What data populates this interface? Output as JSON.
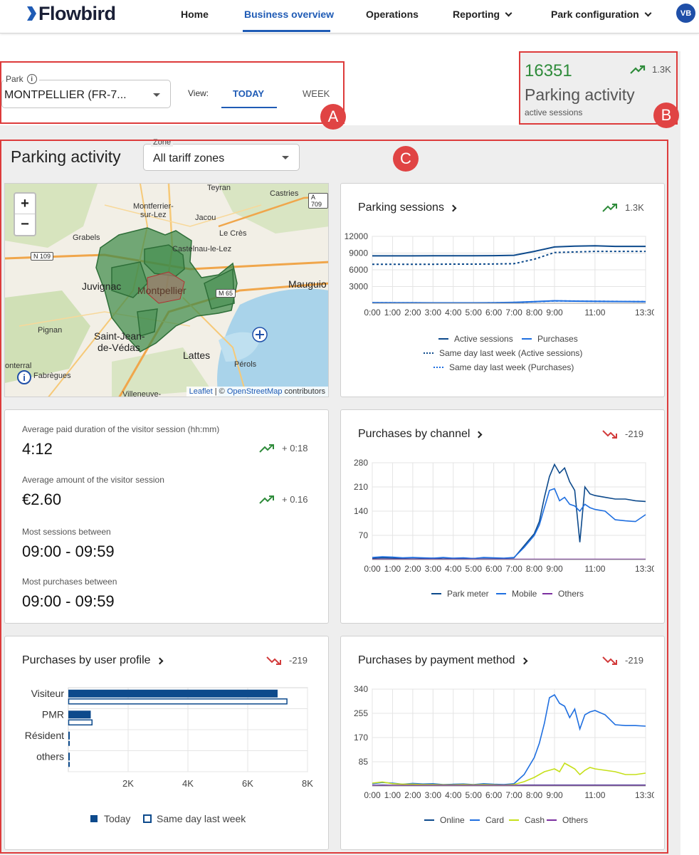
{
  "header": {
    "logo_text": "Flowbird",
    "nav": {
      "home": "Home",
      "business": "Business overview",
      "operations": "Operations",
      "reporting": "Reporting",
      "park_config": "Park configuration"
    },
    "avatar": "VB"
  },
  "filters": {
    "park_label": "Park",
    "park_value": "MONTPELLIER (FR-7...",
    "view_label": "View:",
    "view_today": "TODAY",
    "view_week": "WEEK"
  },
  "kpi": {
    "value": "16351",
    "trend": "1.3K",
    "title": "Parking activity",
    "subtitle": "active sessions"
  },
  "annotations": {
    "a": "A",
    "b": "B",
    "c": "C"
  },
  "section": {
    "title": "Parking activity",
    "zone_label": "Zone",
    "zone_value": "All tariff zones"
  },
  "map": {
    "zoom_in": "+",
    "zoom_out": "−",
    "labels": {
      "teyran": "Teyran",
      "castries": "Castries",
      "montferrier": "Montferrier-",
      "surlez": "sur-Lez",
      "jacou": "Jacou",
      "grabels": "Grabels",
      "lecres": "Le Crès",
      "castelnau": "Castelnau-le-Lez",
      "juvignac": "Juvignac",
      "montpellier": "Montpellier",
      "mauguio": "Mauguio",
      "pignan": "Pignan",
      "saintjean": "Saint-Jean-",
      "devedas": "de-Védas",
      "lattes": "Lattes",
      "perols": "Pérols",
      "onterral": "onterral",
      "fabregues": "Fabrègues",
      "villeneuve": "Villeneuve-"
    },
    "roads": {
      "n109": "N 109",
      "a709": "A 709",
      "m65": "M 65"
    },
    "attribution_leaflet": "Leaflet",
    "attribution_sep": " | © ",
    "attribution_osm": "OpenStreetMap",
    "attribution_rest": " contributors",
    "info": "i"
  },
  "cards": {
    "sessions": {
      "title": "Parking sessions",
      "trend": "1.3K",
      "legend": [
        "Active sessions",
        "Purchases",
        "Same day last week (Active sessions)",
        "Same day last week (Purchases)"
      ]
    },
    "metrics": {
      "m1_label": "Average paid duration of the visitor session (hh:mm)",
      "m1_value": "4:12",
      "m1_trend": "+ 0:18",
      "m2_label": "Average amount of the visitor session",
      "m2_value": "€2.60",
      "m2_trend": "+ 0.16",
      "m3_label": "Most sessions between",
      "m3_value": "09:00 - 09:59",
      "m4_label": "Most purchases between",
      "m4_value": "09:00 - 09:59"
    },
    "channel": {
      "title": "Purchases by channel",
      "trend": "-219",
      "legend": [
        "Park meter",
        "Mobile",
        "Others"
      ]
    },
    "profile": {
      "title": "Purchases by user profile",
      "trend": "-219",
      "legend": [
        "Today",
        "Same day last week"
      ]
    },
    "payment": {
      "title": "Purchases by payment method",
      "trend": "-219",
      "legend": [
        "Online",
        "Card",
        "Cash",
        "Others"
      ]
    }
  },
  "colors": {
    "primary": "#1f5bb5",
    "dark_blue": "#0d4a8c",
    "light_blue": "#1f6fe0",
    "green": "#2e8b3a",
    "red": "#d23b3b",
    "cash": "#c6e01a",
    "purple": "#7b2fa0",
    "zone_green": "#3e8a4a"
  },
  "chart_data": [
    {
      "type": "line",
      "title": "Parking sessions",
      "x": [
        "0:00",
        "1:00",
        "2:00",
        "3:00",
        "4:00",
        "5:00",
        "6:00",
        "7:00",
        "8:00",
        "9:00",
        "10:00",
        "11:00",
        "12:00",
        "13:30"
      ],
      "xticks": [
        "0:00",
        "1:00",
        "2:00",
        "3:00",
        "4:00",
        "5:00",
        "6:00",
        "7:00",
        "8:00",
        "9:00",
        "11:00",
        "13:30"
      ],
      "yticks": [
        3000,
        6000,
        9000,
        12000
      ],
      "ylim": [
        0,
        12000
      ],
      "series": [
        {
          "name": "Active sessions",
          "values": [
            8500,
            8500,
            8500,
            8520,
            8520,
            8520,
            8540,
            8600,
            9300,
            10100,
            10250,
            10300,
            10200,
            10200
          ]
        },
        {
          "name": "Purchases",
          "values": [
            120,
            100,
            90,
            80,
            80,
            80,
            90,
            150,
            300,
            450,
            380,
            350,
            320,
            300
          ]
        },
        {
          "name": "Same day last week (Active sessions)",
          "values": [
            7000,
            7000,
            7000,
            7000,
            7020,
            7020,
            7050,
            7100,
            7900,
            9100,
            9200,
            9300,
            9300,
            9300
          ]
        },
        {
          "name": "Same day last week (Purchases)",
          "values": [
            100,
            90,
            80,
            70,
            70,
            70,
            80,
            140,
            280,
            420,
            400,
            360,
            330,
            300
          ]
        }
      ]
    },
    {
      "type": "line",
      "title": "Purchases by channel",
      "x": [
        "0:00",
        "0:30",
        "1:00",
        "1:30",
        "2:00",
        "2:30",
        "3:00",
        "3:30",
        "4:00",
        "4:30",
        "5:00",
        "5:30",
        "6:00",
        "6:30",
        "7:00",
        "7:30",
        "8:00",
        "8:15",
        "8:30",
        "8:45",
        "9:00",
        "9:15",
        "9:30",
        "9:45",
        "10:00",
        "10:15",
        "10:30",
        "10:45",
        "11:00",
        "11:30",
        "12:00",
        "12:30",
        "13:00",
        "13:30"
      ],
      "xticks": [
        "0:00",
        "1:00",
        "2:00",
        "3:00",
        "4:00",
        "5:00",
        "6:00",
        "7:00",
        "8:00",
        "9:00",
        "11:00",
        "13:30"
      ],
      "yticks": [
        70,
        140,
        210,
        280
      ],
      "ylim": [
        0,
        280
      ],
      "series": [
        {
          "name": "Park meter",
          "values": [
            3,
            5,
            4,
            3,
            5,
            3,
            4,
            2,
            3,
            4,
            3,
            5,
            4,
            3,
            5,
            40,
            75,
            110,
            180,
            240,
            275,
            250,
            265,
            225,
            200,
            50,
            210,
            190,
            185,
            180,
            175,
            175,
            170,
            168
          ]
        },
        {
          "name": "Mobile",
          "values": [
            6,
            8,
            7,
            5,
            6,
            5,
            4,
            6,
            4,
            5,
            3,
            6,
            5,
            4,
            6,
            35,
            70,
            100,
            150,
            200,
            205,
            170,
            180,
            160,
            155,
            140,
            160,
            150,
            145,
            140,
            115,
            112,
            110,
            130
          ]
        },
        {
          "name": "Others",
          "values": [
            1,
            1,
            1,
            1,
            1,
            1,
            1,
            1,
            1,
            1,
            1,
            1,
            1,
            1,
            1,
            1,
            1,
            1,
            1,
            1,
            1,
            1,
            1,
            1,
            1,
            1,
            1,
            1,
            1,
            1,
            1,
            1,
            1,
            1
          ]
        }
      ]
    },
    {
      "type": "bar",
      "title": "Purchases by user profile",
      "categories": [
        "Visiteur",
        "PMR",
        "Résident",
        "others"
      ],
      "xticks": [
        "2K",
        "4K",
        "6K",
        "8K"
      ],
      "xlim": [
        0,
        8000
      ],
      "series": [
        {
          "name": "Today",
          "values": [
            7000,
            750,
            40,
            40
          ]
        },
        {
          "name": "Same day last week",
          "values": [
            7300,
            780,
            0,
            0
          ]
        }
      ]
    },
    {
      "type": "line",
      "title": "Purchases by payment method",
      "x": [
        "0:00",
        "0:30",
        "1:00",
        "1:30",
        "2:00",
        "2:30",
        "3:00",
        "3:30",
        "4:00",
        "4:30",
        "5:00",
        "5:30",
        "6:00",
        "6:30",
        "7:00",
        "7:30",
        "8:00",
        "8:15",
        "8:30",
        "8:45",
        "9:00",
        "9:15",
        "9:30",
        "9:45",
        "10:00",
        "10:15",
        "10:30",
        "10:45",
        "11:00",
        "11:30",
        "12:00",
        "12:30",
        "13:00",
        "13:30"
      ],
      "xticks": [
        "0:00",
        "1:00",
        "2:00",
        "3:00",
        "4:00",
        "5:00",
        "6:00",
        "7:00",
        "8:00",
        "9:00",
        "11:00",
        "13:30"
      ],
      "yticks": [
        85,
        170,
        255,
        340
      ],
      "ylim": [
        0,
        340
      ],
      "series": [
        {
          "name": "Online",
          "values": [
            2,
            3,
            2,
            2,
            3,
            2,
            3,
            2,
            2,
            3,
            2,
            3,
            2,
            3,
            2,
            3,
            3,
            3,
            3,
            3,
            3,
            3,
            3,
            3,
            3,
            3,
            3,
            3,
            3,
            3,
            3,
            3,
            3,
            3
          ]
        },
        {
          "name": "Card",
          "values": [
            8,
            12,
            10,
            6,
            9,
            7,
            8,
            5,
            6,
            7,
            5,
            8,
            6,
            5,
            8,
            40,
            100,
            150,
            220,
            310,
            320,
            290,
            280,
            240,
            270,
            200,
            250,
            260,
            265,
            250,
            215,
            212,
            212,
            210
          ]
        },
        {
          "name": "Cash",
          "values": [
            10,
            14,
            8,
            6,
            6,
            5,
            5,
            4,
            4,
            5,
            4,
            5,
            4,
            3,
            5,
            15,
            30,
            40,
            50,
            55,
            60,
            50,
            80,
            70,
            60,
            40,
            55,
            65,
            60,
            55,
            50,
            40,
            40,
            45
          ]
        },
        {
          "name": "Others",
          "values": [
            2,
            2,
            2,
            2,
            2,
            2,
            2,
            2,
            2,
            2,
            2,
            2,
            2,
            2,
            2,
            2,
            2,
            2,
            2,
            2,
            2,
            2,
            2,
            2,
            2,
            2,
            2,
            2,
            2,
            2,
            2,
            2,
            2,
            2
          ]
        }
      ]
    }
  ]
}
